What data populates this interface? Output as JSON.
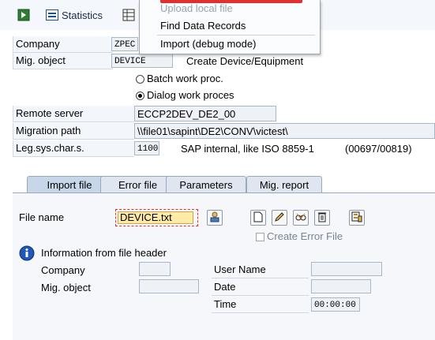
{
  "toolbar": {
    "statistics_label": "Statistics"
  },
  "menu": {
    "items": [
      {
        "label": "Upload local file",
        "disabled": true
      },
      {
        "label": "Find Data Records",
        "disabled": false
      },
      {
        "label": "Import (debug mode)",
        "disabled": false
      }
    ]
  },
  "form": {
    "company_label": "Company",
    "company_value": "ZPEC",
    "mig_object_label": "Mig. object",
    "mig_object_value": "DEVICE",
    "mig_object_desc": "Create Device/Equipment",
    "batch_label": "Batch work proc.",
    "dialog_label": "Dialog work proces",
    "remote_server_label": "Remote server",
    "remote_server_value": "ECCP2DEV_DE2_00",
    "migration_path_label": "Migration path",
    "migration_path_value": "\\\\file01\\sapint\\DE2\\CONV\\victest\\",
    "legsys_label": "Leg.sys.char.s.",
    "legsys_value": "1100",
    "legsys_desc": "SAP internal, like ISO 8859-1",
    "legsys_code": "(00697/00819)"
  },
  "tabs": [
    {
      "label": "Import file",
      "active": true
    },
    {
      "label": "Error file",
      "active": false
    },
    {
      "label": "Parameters",
      "active": false
    },
    {
      "label": "Mig. report",
      "active": false
    }
  ],
  "import_tab": {
    "file_name_label": "File name",
    "file_name_value": "DEVICE.txt",
    "create_error_file_label": "Create Error File",
    "info_header": "Information from file header",
    "company_label": "Company",
    "company_value": "",
    "mig_object_label": "Mig. object",
    "mig_object_value": "",
    "user_name_label": "User Name",
    "user_name_value": "",
    "date_label": "Date",
    "date_value": "",
    "time_label": "Time",
    "time_value": "00:00:00"
  },
  "colors": {
    "accent_red": "#e03030",
    "tab_active": "#c7d6e8",
    "field_bg": "#eef2f7"
  }
}
